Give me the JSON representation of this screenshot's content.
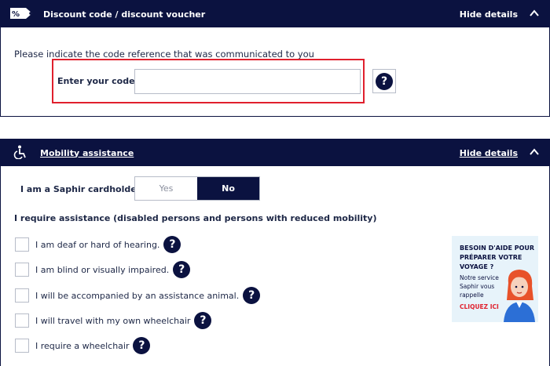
{
  "discount": {
    "title": "Discount code / discount voucher",
    "hide_label": "Hide details",
    "intro": "Please indicate the code reference that was communicated to you",
    "code_label": "Enter your code",
    "code_value": "",
    "help_glyph": "?"
  },
  "mobility": {
    "title": "Mobility assistance",
    "hide_label": "Hide details",
    "saphir_label": "I am a Saphir cardholder",
    "toggle": {
      "yes": "Yes",
      "no": "No",
      "selected": "No"
    },
    "requirement_title": "I require assistance (disabled persons and persons with reduced mobility)",
    "options": [
      {
        "label": "I am deaf or hard of hearing.",
        "checked": false
      },
      {
        "label": "I am blind or visually impaired.",
        "checked": false
      },
      {
        "label": "I will be accompanied by an assistance animal.",
        "checked": false
      },
      {
        "label": "I will travel with my own wheelchair",
        "checked": false
      },
      {
        "label": "I require a wheelchair",
        "checked": false
      }
    ],
    "help_glyph": "?",
    "banner": {
      "headline": "BESOIN D'AIDE POUR PRÉPARER VOTRE VOYAGE ?",
      "body": "Notre service Saphir vous rappelle",
      "cta": "CLIQUEZ ICI"
    }
  },
  "colors": {
    "navy": "#0b1240",
    "accent_red": "#e0202d",
    "border_grey": "#b7bcc8"
  }
}
